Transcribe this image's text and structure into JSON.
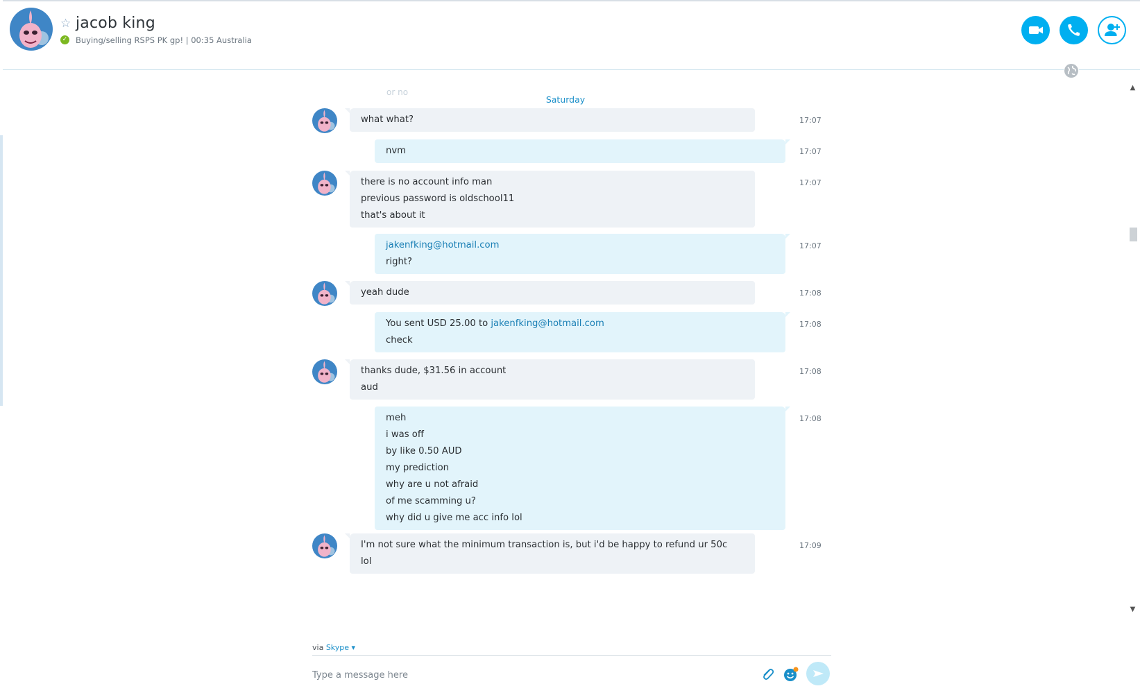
{
  "header": {
    "contact_name": "jacob king",
    "mood": "Buying/selling RSPS PK gp!  |  00:35 Australia",
    "presence": "online",
    "buttons": {
      "video": "video-call",
      "call": "audio-call",
      "add": "add-participants"
    }
  },
  "conversation": {
    "ghost_text": "or no",
    "day_label": "Saturday",
    "messages": [
      {
        "dir": "in",
        "lines": [
          "what what?"
        ],
        "time": "17:07"
      },
      {
        "dir": "out",
        "lines": [
          "nvm"
        ],
        "time": "17:07"
      },
      {
        "dir": "in",
        "lines": [
          "there is no account info man",
          "previous password is oldschool11",
          "that's about it"
        ],
        "time": "17:07"
      },
      {
        "dir": "out",
        "lines": [
          [
            {
              "t": "jakenfking@hotmail.com",
              "link": true
            }
          ],
          "right?"
        ],
        "time": "17:07"
      },
      {
        "dir": "in",
        "lines": [
          "yeah dude"
        ],
        "time": "17:08"
      },
      {
        "dir": "out",
        "lines": [
          [
            {
              "t": "You sent USD 25.00 to "
            },
            {
              "t": "jakenfking@hotmail.com",
              "link": true
            }
          ],
          "check"
        ],
        "time": "17:08"
      },
      {
        "dir": "in",
        "lines": [
          "thanks dude, $31.56 in account",
          "aud"
        ],
        "time": "17:08"
      },
      {
        "dir": "out",
        "lines": [
          "meh",
          "i was off",
          "by like 0.50 AUD",
          "my prediction",
          "why are u not afraid",
          "of me scamming u?",
          "why did u give me acc info lol"
        ],
        "time": "17:08"
      },
      {
        "dir": "in",
        "lines": [
          "I'm not sure what the minimum transaction is, but i'd be happy to refund ur 50c",
          "lol"
        ],
        "time": "17:09"
      }
    ]
  },
  "composer": {
    "via_prefix": "via ",
    "via_service": "Skype",
    "placeholder": "Type a message here",
    "value": ""
  },
  "colors": {
    "accent": "#00aff0",
    "incoming_bubble": "#eef2f6",
    "outgoing_bubble": "#e2f4fb",
    "link": "#1a7fb5",
    "presence_online": "#7cb821"
  },
  "icons": {
    "favorite": "star-outline-icon",
    "video": "video-camera-icon",
    "call": "phone-icon",
    "add": "add-person-icon",
    "globe": "globe-icon",
    "attach": "paperclip-icon",
    "emoji": "emoticon-icon",
    "send": "send-icon"
  }
}
